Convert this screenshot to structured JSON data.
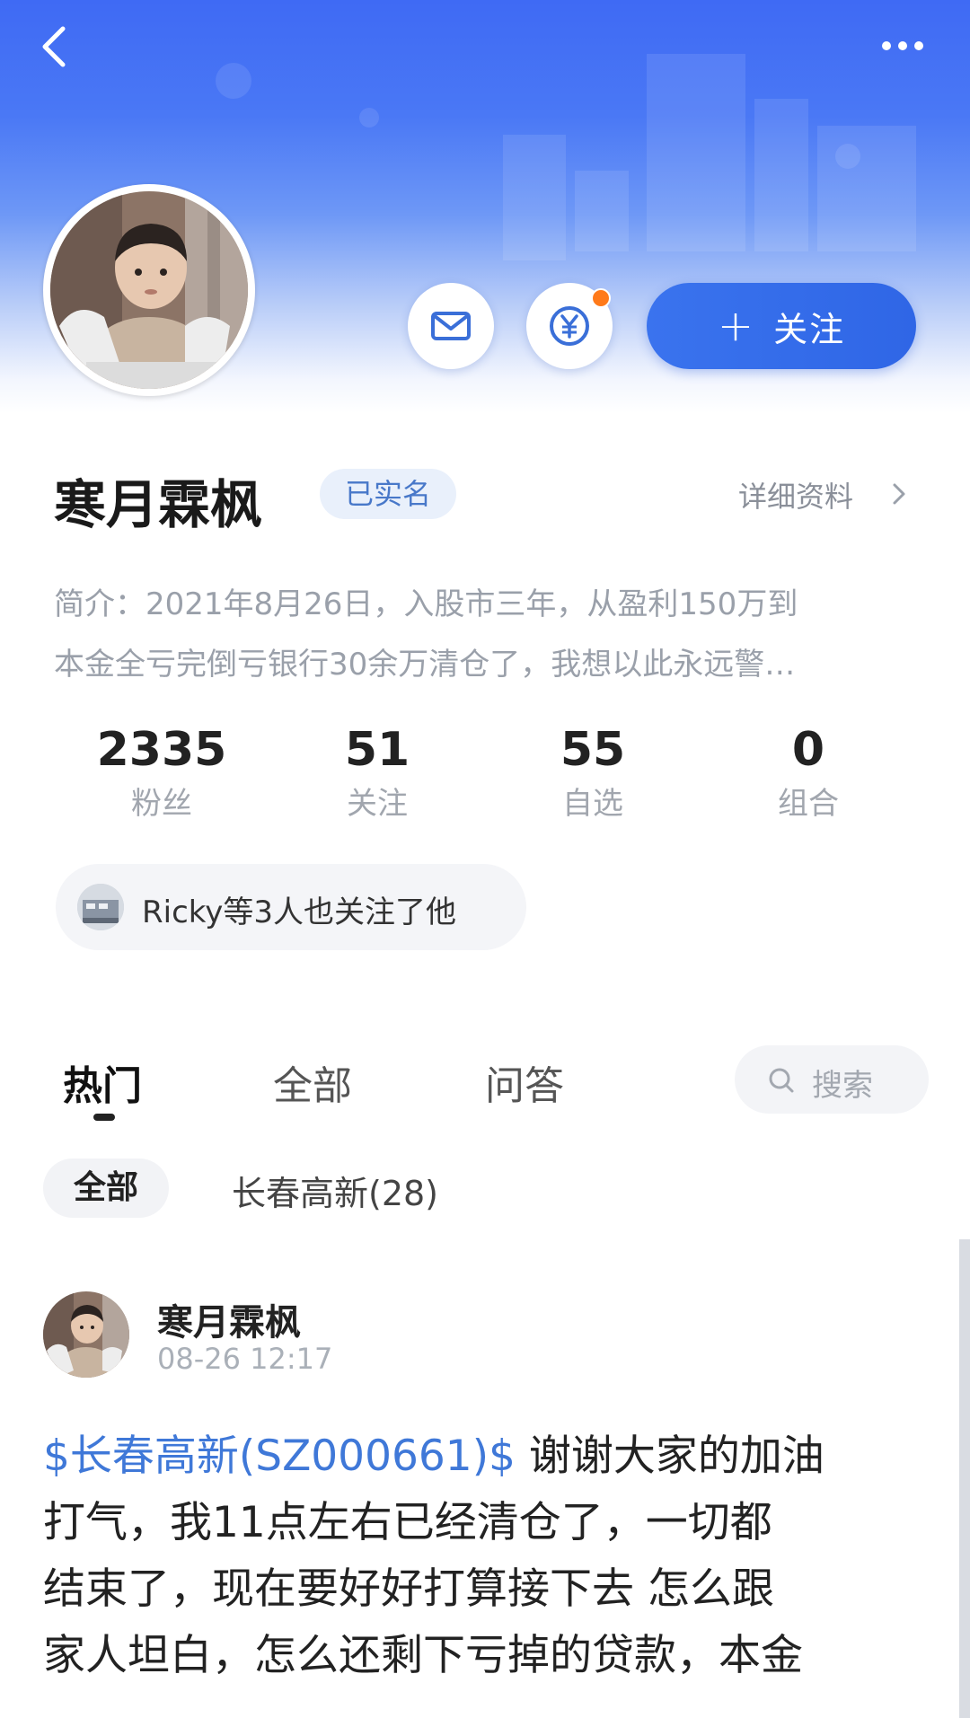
{
  "header": {
    "back_icon": "back-arrow-icon",
    "more_icon": "more-dots-icon"
  },
  "profile": {
    "name": "寒月霖枫",
    "verified_badge": "已实名",
    "detail_link": "详细资料",
    "bio_line1": "简介：2021年8月26日，入股市三年，从盈利150万到",
    "bio_line2": "本金全亏完倒亏银行30余万清仓了，我想以此永远警…",
    "actions": {
      "message_icon": "mail-icon",
      "reward_icon": "yuan-coin-icon",
      "follow_label": "关注"
    }
  },
  "stats": [
    {
      "value": "2335",
      "label": "粉丝"
    },
    {
      "value": "51",
      "label": "关注"
    },
    {
      "value": "55",
      "label": "自选"
    },
    {
      "value": "0",
      "label": "组合"
    }
  ],
  "mutual_followers": "Ricky等3人也关注了他",
  "tabs": [
    {
      "label": "热门",
      "active": true
    },
    {
      "label": "全部",
      "active": false
    },
    {
      "label": "问答",
      "active": false
    }
  ],
  "search": {
    "placeholder": "搜索"
  },
  "filters": [
    {
      "label": "全部",
      "active": true
    },
    {
      "label": "长春高新(28)",
      "active": false
    }
  ],
  "post": {
    "author": "寒月霖枫",
    "time": "08-26 12:17",
    "stock_tag": "$长春高新(SZ000661)$",
    "line1_rest": " 谢谢大家的加油",
    "line2": "打气，我11点左右已经清仓了，一切都",
    "line3": "结束了，现在要好好打算接下去 怎么跟",
    "line4": "家人坦白，怎么还剩下亏掉的贷款，本金"
  },
  "colors": {
    "accent": "#3a73ee",
    "link": "#3f78d8",
    "badge_bg": "#e9f0fb",
    "notify": "#ff7a1a"
  }
}
